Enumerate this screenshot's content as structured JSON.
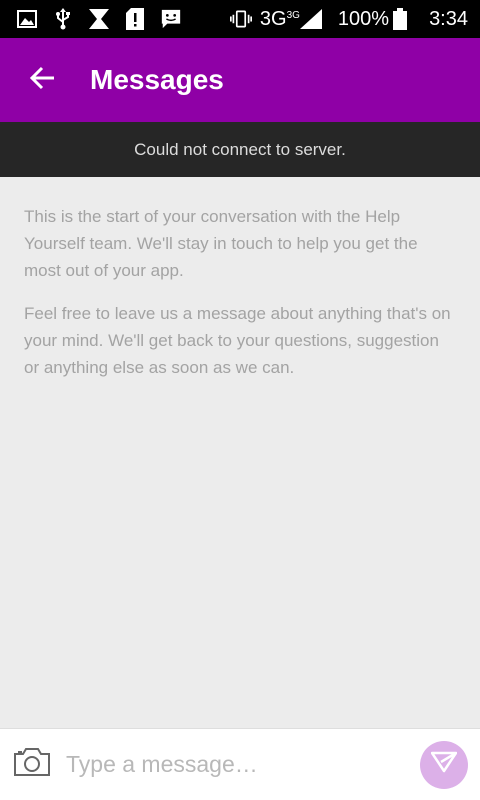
{
  "status_bar": {
    "icons_left": [
      "image-icon",
      "usb-icon",
      "hourglass-icon",
      "sim-alert-icon",
      "chat-bubble-icon"
    ],
    "network_type": "3G",
    "network_type_sup": "3G",
    "battery_percent": "100%",
    "time": "3:34"
  },
  "app_bar": {
    "title": "Messages",
    "back_icon": "arrow-left-icon",
    "background_color": "#8f00a6"
  },
  "banner": {
    "text": "Could not connect to server."
  },
  "conversation": {
    "intro_paragraphs": [
      "This is the start of your conversation with the Help Yourself team. We'll stay in touch to help you get the most out of your app.",
      "Feel free to leave us a message about anything that's on your mind. We'll get back to your questions, suggestion or anything else as soon as we can."
    ]
  },
  "composer": {
    "placeholder": "Type a message…",
    "value": "",
    "camera_icon": "camera-icon",
    "send_icon": "send-icon",
    "send_color": "#dcb0e8"
  }
}
